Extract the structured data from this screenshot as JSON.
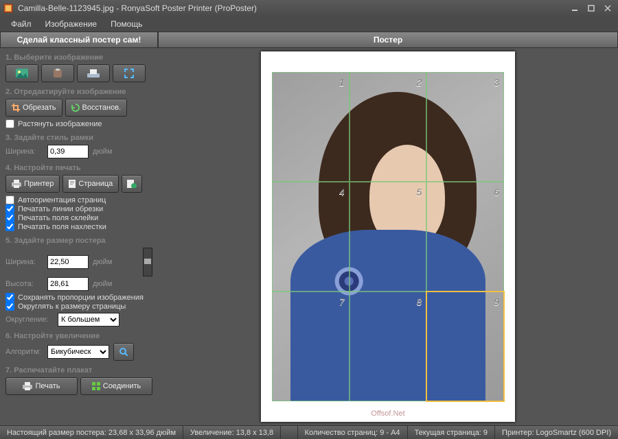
{
  "window": {
    "title": "Camilla-Belle-1123945.jpg - RonyaSoft Poster Printer (ProPoster)"
  },
  "menu": {
    "file": "Файл",
    "image": "Изображение",
    "help": "Помощь"
  },
  "sidebar": {
    "header": "Сделай классный постер сам!",
    "s1": "1. Выберите изображение",
    "s2": "2. Отредактируйте изображение",
    "crop": "Обрезать",
    "restore": "Восстанов.",
    "stretch": "Растянуть изображение",
    "s3": "3. Задайте стиль рамки",
    "width_lbl": "Ширина:",
    "width_val": "0,39",
    "width_unit": "дюйм",
    "s4": "4. Настройте печать",
    "printer": "Принтер",
    "page": "Страница",
    "auto_orient": "Автоориентация страниц",
    "print_cut": "Печатать линии обрезки",
    "print_glue": "Печатать поля склейки",
    "print_overlap": "Печатать поля нахлестки",
    "s5": "5. Задайте размер постера",
    "pw_lbl": "Ширина:",
    "pw_val": "22,50",
    "ph_lbl": "Высота:",
    "ph_val": "28,61",
    "size_unit": "дюйм",
    "keep_aspect": "Сохранять пропорции изображения",
    "round_page": "Округлять к размеру страницы",
    "round_lbl": "Округление:",
    "round_sel": "К большем",
    "s6": "6. Настройте увеличение",
    "alg_lbl": "Алгоритм:",
    "alg_sel": "Бикубическ",
    "s7": "7. Распечатайте плакат",
    "print": "Печать",
    "join": "Соединить"
  },
  "checks": {
    "stretch": false,
    "auto_orient": false,
    "print_cut": true,
    "print_glue": true,
    "print_overlap": true,
    "keep_aspect": true,
    "round_page": true
  },
  "main": {
    "header": "Постер",
    "watermark": "Offsof.Net"
  },
  "grid": {
    "cells": [
      "1",
      "2",
      "3",
      "4",
      "5",
      "6",
      "7",
      "8",
      "9"
    ],
    "selected": 9
  },
  "status": {
    "real_size": "Настоящий размер постера: 23,68 x 33,96 дюйм",
    "zoom": "Увеличение: 13,8 x 13,8",
    "pages": "Количество страниц: 9 - A4",
    "current": "Текущая страница: 9",
    "printer": "Принтер: LogoSmartz (600 DPI)"
  },
  "colors": {
    "accent": "#f0c040"
  }
}
